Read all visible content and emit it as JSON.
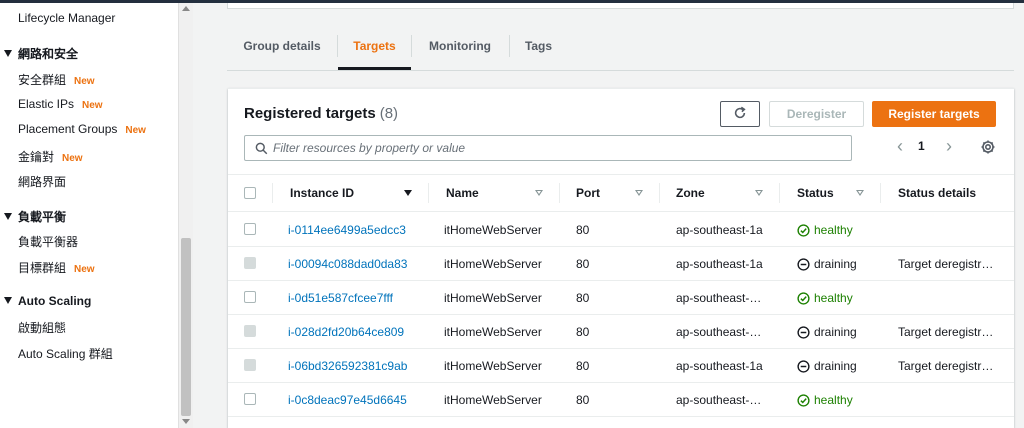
{
  "sidebar": {
    "items": [
      {
        "label": "Lifecycle Manager",
        "new": ""
      },
      {
        "section": "網路和安全"
      },
      {
        "label": "安全群組",
        "new": "New"
      },
      {
        "label": "Elastic IPs",
        "new": "New"
      },
      {
        "label": "Placement Groups",
        "new": "New"
      },
      {
        "label": "金鑰對",
        "new": "New"
      },
      {
        "label": "網路界面",
        "new": ""
      },
      {
        "section": "負載平衡"
      },
      {
        "label": "負載平衡器",
        "new": ""
      },
      {
        "label": "目標群組",
        "new": "New"
      },
      {
        "section": "Auto Scaling"
      },
      {
        "label": "啟動組態",
        "new": ""
      },
      {
        "label": "Auto Scaling 群組",
        "new": ""
      }
    ]
  },
  "tabs": [
    {
      "label": "Group details",
      "active": false
    },
    {
      "label": "Targets",
      "active": true
    },
    {
      "label": "Monitoring",
      "active": false
    },
    {
      "label": "Tags",
      "active": false
    }
  ],
  "panel": {
    "title": "Registered targets",
    "count": "(8)",
    "deregister_label": "Deregister",
    "register_label": "Register targets",
    "filter_placeholder": "Filter resources by property or value",
    "page_number": "1"
  },
  "table": {
    "columns": [
      "Instance ID",
      "Name",
      "Port",
      "Zone",
      "Status",
      "Status details"
    ],
    "rows": [
      {
        "instance_id": "i-0114ee6499a5edcc3",
        "name": "itHomeWebServer",
        "port": "80",
        "zone": "ap-southeast-1a",
        "status": "healthy",
        "details": "",
        "selectable": true
      },
      {
        "instance_id": "i-00094c088dad0da83",
        "name": "itHomeWebServer",
        "port": "80",
        "zone": "ap-southeast-1a",
        "status": "draining",
        "details": "Target deregistr…",
        "selectable": false
      },
      {
        "instance_id": "i-0d51e587cfcee7fff",
        "name": "itHomeWebServer",
        "port": "80",
        "zone": "ap-southeast-…",
        "status": "healthy",
        "details": "",
        "selectable": true
      },
      {
        "instance_id": "i-028d2fd20b64ce809",
        "name": "itHomeWebServer",
        "port": "80",
        "zone": "ap-southeast-…",
        "status": "draining",
        "details": "Target deregistr…",
        "selectable": false
      },
      {
        "instance_id": "i-06bd326592381c9ab",
        "name": "itHomeWebServer",
        "port": "80",
        "zone": "ap-southeast-1a",
        "status": "draining",
        "details": "Target deregistr…",
        "selectable": false
      },
      {
        "instance_id": "i-0c8deac97e45d6645",
        "name": "itHomeWebServer",
        "port": "80",
        "zone": "ap-southeast-…",
        "status": "healthy",
        "details": "",
        "selectable": true
      }
    ]
  },
  "colors": {
    "accent": "#ec7211",
    "link": "#0073bb",
    "healthy": "#1d8102"
  }
}
